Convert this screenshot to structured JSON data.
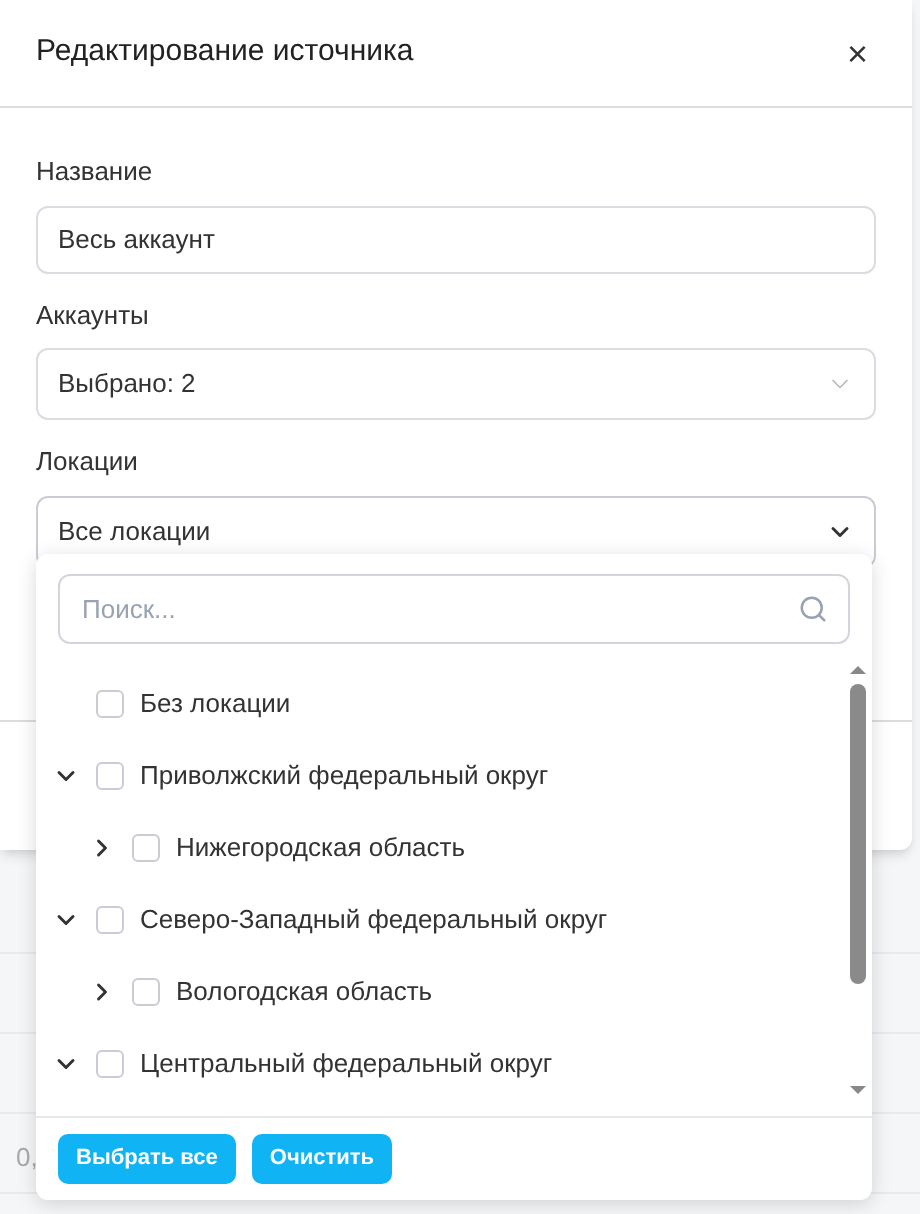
{
  "dialog": {
    "title": "Редактирование источника",
    "close": "×"
  },
  "fields": [
    {
      "label": "Название",
      "value": "Весь аккаунт",
      "kind": "text"
    },
    {
      "label": "Аккаунты",
      "value": "Выбрано: 2",
      "kind": "select",
      "expanded": false
    },
    {
      "label": "Локации",
      "value": "Все локации",
      "kind": "select",
      "expanded": true
    }
  ],
  "dropdown": {
    "search": {
      "placeholder": "Поиск..."
    },
    "tree": [
      {
        "label": "Без локации",
        "checked": false
      },
      {
        "label": "Приволжский федеральный округ",
        "checked": false,
        "expanded": true,
        "children": [
          {
            "label": "Нижегородская область",
            "checked": false,
            "expanded": false
          }
        ]
      },
      {
        "label": "Северо-Западный федеральный округ",
        "checked": false,
        "expanded": true,
        "children": [
          {
            "label": "Вологодская область",
            "checked": false,
            "expanded": false
          }
        ]
      },
      {
        "label": "Центральный федеральный округ",
        "checked": false,
        "expanded": true
      }
    ],
    "buttons": [
      "Выбрать все",
      "Очистить"
    ]
  },
  "background_text": "0,"
}
